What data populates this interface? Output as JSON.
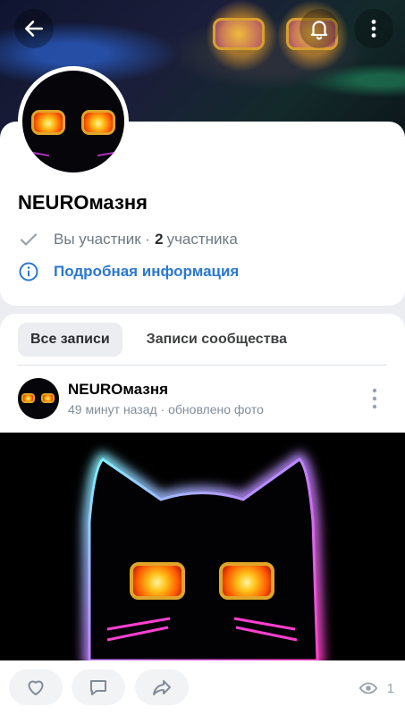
{
  "header": {
    "back_icon": "arrow-left-icon",
    "bell_icon": "bell-icon",
    "more_icon": "more-vertical-icon"
  },
  "community": {
    "name": "NEUROмазня",
    "membership_status": "Вы участник ·",
    "member_count": "2",
    "member_label": "участника",
    "info_link": "Подробная информация"
  },
  "tabs": [
    {
      "label": "Все записи",
      "active": true
    },
    {
      "label": "Записи сообщества",
      "active": false
    }
  ],
  "post": {
    "author": "NEUROмазня",
    "meta": "49 минут назад · обновлено фото",
    "views": "1"
  },
  "colors": {
    "accent": "#2a78d2",
    "secondary_text": "#6d7885",
    "background": "#ebedf0"
  }
}
